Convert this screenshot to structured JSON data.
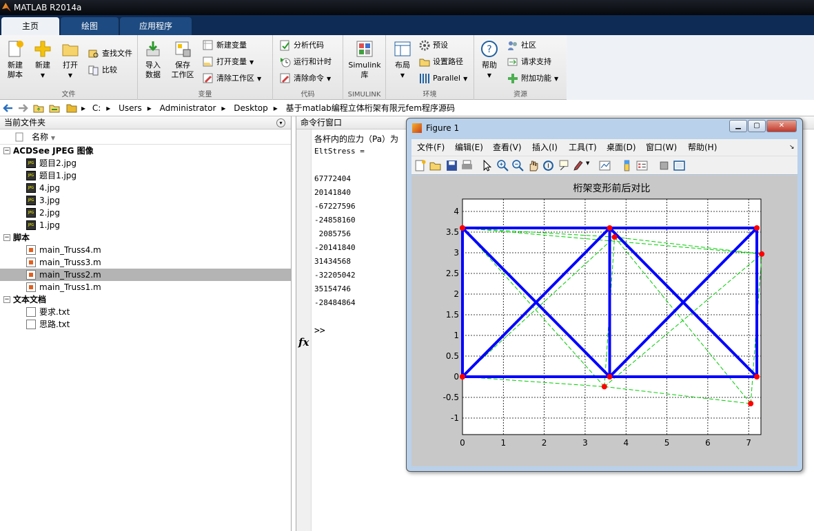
{
  "window": {
    "title": "MATLAB R2014a"
  },
  "tabs": [
    "主页",
    "绘图",
    "应用程序"
  ],
  "ribbon": {
    "file": {
      "label": "文件",
      "new_script": "新建\n脚本",
      "new": "新建",
      "open": "打开",
      "find_files": "查找文件",
      "compare": "比较"
    },
    "variable": {
      "label": "变量",
      "import": "导入\n数据",
      "save_ws": "保存\n工作区",
      "new_var": "新建变量",
      "open_var": "打开变量",
      "clear_ws": "清除工作区"
    },
    "code": {
      "label": "代码",
      "analyze": "分析代码",
      "run_time": "运行和计时",
      "clear_cmd": "清除命令"
    },
    "simulink": {
      "label": "SIMULINK",
      "lib": "Simulink\n库"
    },
    "env": {
      "label": "环境",
      "layout": "布局",
      "prefs": "预设",
      "set_path": "设置路径",
      "parallel": "Parallel"
    },
    "resources": {
      "label": "资源",
      "help": "帮助",
      "community": "社区",
      "support": "请求支持",
      "addons": "附加功能"
    }
  },
  "address": {
    "path": [
      "C:",
      "Users",
      "Administrator",
      "Desktop",
      "基于matlab编程立体桁架有限元fem程序源码"
    ]
  },
  "current_folder": {
    "title": "当前文件夹",
    "column": "名称",
    "sections": [
      {
        "name": "ACDSee JPEG 图像",
        "kind": "jpg",
        "files": [
          "题目2.jpg",
          "题目1.jpg",
          "4.jpg",
          "3.jpg",
          "2.jpg",
          "1.jpg"
        ]
      },
      {
        "name": "脚本",
        "kind": "m",
        "files": [
          "main_Truss4.m",
          "main_Truss3.m",
          "main_Truss2.m",
          "main_Truss1.m"
        ]
      },
      {
        "name": "文本文档",
        "kind": "txt",
        "files": [
          "要求.txt",
          "思路.txt"
        ]
      }
    ],
    "selected": "main_Truss2.m"
  },
  "command_window": {
    "title": "命令行窗口",
    "lines": [
      "各杆内的应力（Pa）为",
      "EltStress =",
      "",
      "67772404",
      "20141840",
      "-67227596",
      "-24858160",
      " 2085756",
      "-20141840",
      "31434568",
      "-32205042",
      "35154746",
      "-28484864"
    ],
    "prompt": ">>"
  },
  "figure": {
    "title": "Figure 1",
    "menus": [
      "文件(F)",
      "编辑(E)",
      "查看(V)",
      "插入(I)",
      "工具(T)",
      "桌面(D)",
      "窗口(W)",
      "帮助(H)"
    ],
    "chart_data": {
      "type": "line",
      "title": "桁架变形前后对比",
      "xlim": [
        0,
        7.3
      ],
      "ylim": [
        -1.4,
        4.3
      ],
      "xticks": [
        0,
        1,
        2,
        3,
        4,
        5,
        6,
        7
      ],
      "yticks": [
        -1,
        -0.5,
        0,
        0.5,
        1,
        1.5,
        2,
        2.5,
        3,
        3.5,
        4
      ],
      "grid": true,
      "series": [
        {
          "style": "original",
          "color": "#0000ff",
          "nodes": [
            [
              0,
              0
            ],
            [
              3.6,
              0
            ],
            [
              7.2,
              0
            ],
            [
              0,
              3.6
            ],
            [
              3.6,
              3.6
            ],
            [
              7.2,
              3.6
            ]
          ],
          "elements": [
            [
              0,
              1
            ],
            [
              1,
              2
            ],
            [
              3,
              4
            ],
            [
              4,
              5
            ],
            [
              0,
              3
            ],
            [
              1,
              4
            ],
            [
              2,
              5
            ],
            [
              0,
              4
            ],
            [
              1,
              3
            ],
            [
              1,
              5
            ],
            [
              2,
              4
            ]
          ]
        },
        {
          "style": "deformed",
          "color": "#00cc00",
          "nodes": [
            [
              0,
              0
            ],
            [
              3.47,
              -0.24
            ],
            [
              7.05,
              -0.65
            ],
            [
              0,
              3.6
            ],
            [
              3.72,
              3.38
            ],
            [
              7.32,
              2.97
            ]
          ],
          "elements": [
            [
              0,
              1
            ],
            [
              1,
              2
            ],
            [
              3,
              4
            ],
            [
              4,
              5
            ],
            [
              0,
              3
            ],
            [
              1,
              4
            ],
            [
              2,
              5
            ],
            [
              0,
              4
            ],
            [
              1,
              3
            ],
            [
              1,
              5
            ],
            [
              2,
              4
            ],
            [
              3,
              5
            ]
          ]
        }
      ]
    }
  }
}
